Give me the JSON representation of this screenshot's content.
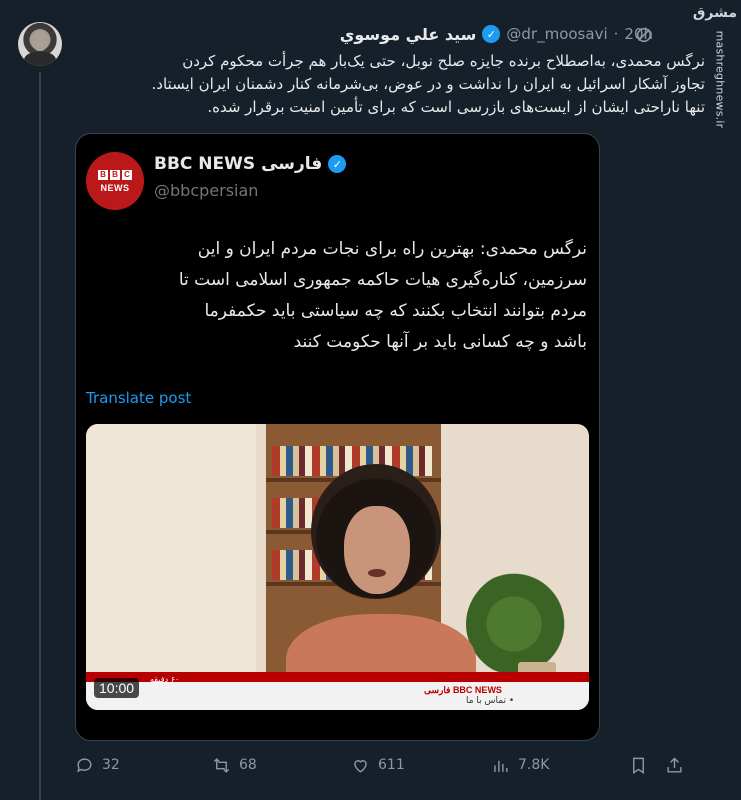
{
  "author": {
    "name": "سيد علي موسوي",
    "handle": "@dr_moosavi",
    "separator": "·",
    "time": "20h"
  },
  "tweet": {
    "line1": "نرگس محمدی، به‌اصطلاح برنده جایزه صلح نوبل، حتی یک‌بار هم جرأت محکوم کردن",
    "line2": "تجاوز آشکار اسرائیل به ایران را نداشت و در عوض، بی‌شرمانه کنار دشمنان ایران ایستاد.",
    "line3": "تنها ناراحتی ایشان از ایست‌های بازرسی است که برای تأمین امنیت برقرار شده."
  },
  "watermark": {
    "logo": "مشرق",
    "url": "mashreghnews.ir"
  },
  "quoted": {
    "name": "BBC NEWS فارسی",
    "handle": "@bbcpersian",
    "avatar_letters": [
      "B",
      "B",
      "C"
    ],
    "avatar_word": "NEWS",
    "line1": "نرگس محمدی: بهترین راه برای نجات مردم ایران و این",
    "line2": "سرزمین، کناره‌گیری هیات حاکمه جمهوری اسلامی است تا",
    "line3": "مردم بتوانند انتخاب بکنند که چه سیاستی باید حکمفرما",
    "line4": "باشد و چه کسانی باید بر آنها حکومت کنند",
    "translate": "Translate post",
    "video": {
      "duration": "10:00",
      "minutes_label": "۶۰ دقیقه",
      "channel": "BBC NEWS فارسی",
      "ticker": "• تماس با ما"
    }
  },
  "actions": {
    "replies": "32",
    "reposts": "68",
    "likes": "611",
    "views": "7.8K"
  },
  "colors": {
    "background": "#15202b",
    "accent": "#1d9bf0",
    "bbc_red": "#bb1919"
  }
}
